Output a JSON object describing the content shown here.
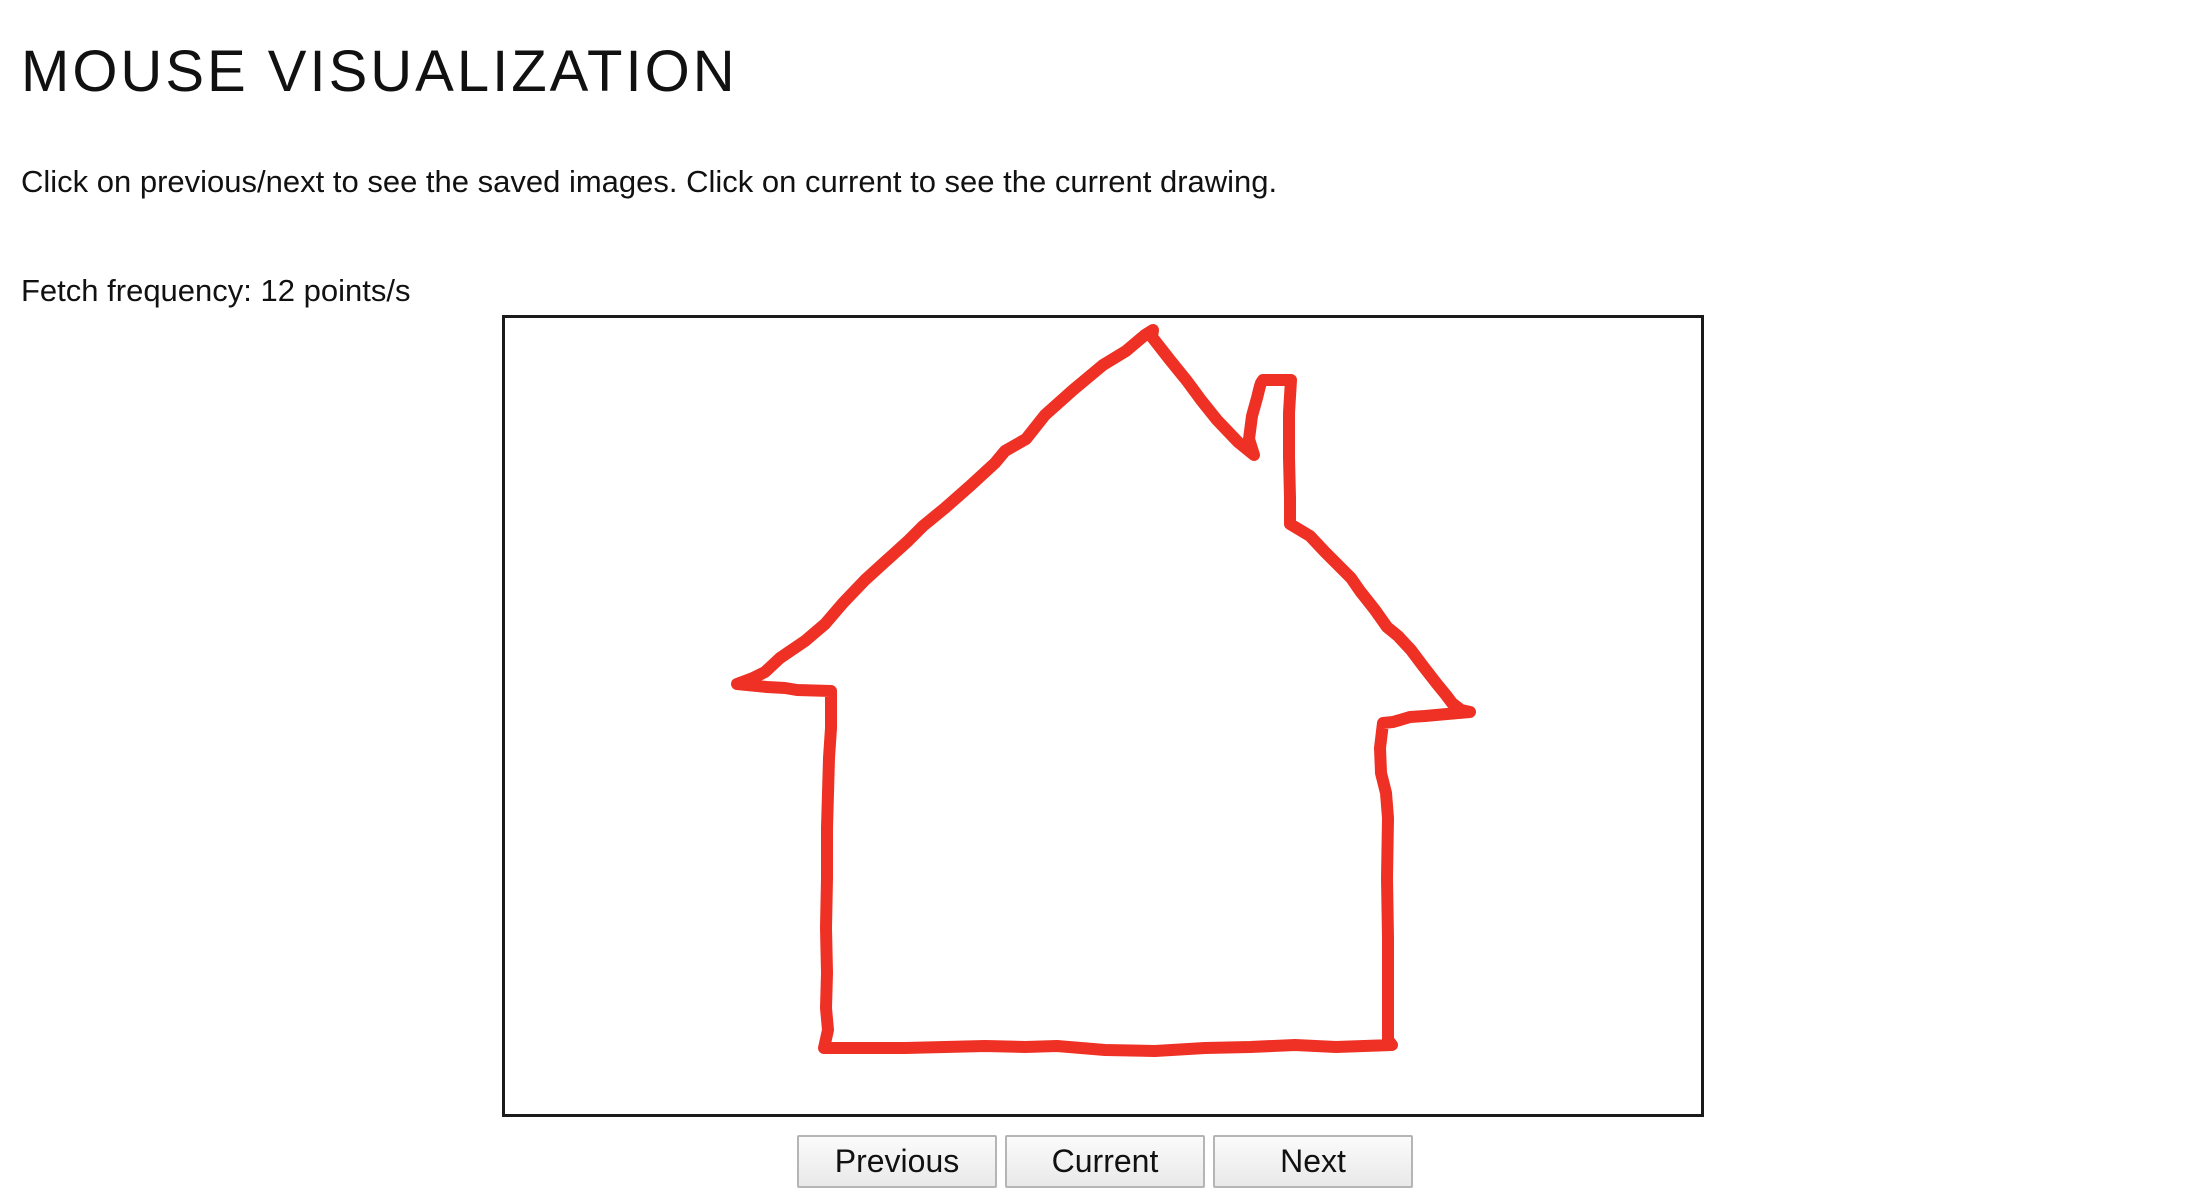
{
  "page": {
    "title": "MOUSE VISUALIZATION",
    "instructions": "Click on previous/next to see the saved images. Click on current to see the current drawing.",
    "fetch_frequency": "Fetch frequency: 12 points/s"
  },
  "drawing": {
    "stroke_color": "#ee3124",
    "background_color": "#ffffff",
    "frame_color": "#1a1a1a",
    "subject": "hand-drawn red house outline with chimney"
  },
  "controls": {
    "previous_label": "Previous",
    "current_label": "Current",
    "next_label": "Next"
  }
}
